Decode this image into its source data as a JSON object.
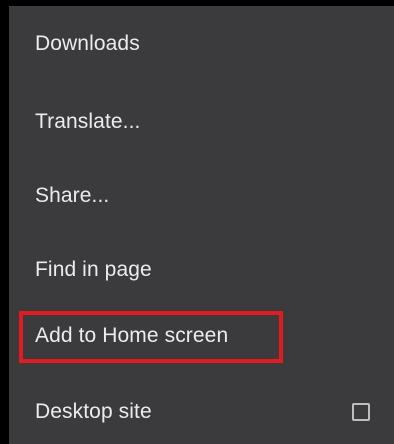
{
  "menu": {
    "items": [
      {
        "label": "Downloads"
      },
      {
        "label": "Translate..."
      },
      {
        "label": "Share..."
      },
      {
        "label": "Find in page"
      },
      {
        "label": "Add to Home screen"
      },
      {
        "label": "Desktop site",
        "checkbox_checked": false
      }
    ],
    "highlight_color": "#e01b22"
  }
}
